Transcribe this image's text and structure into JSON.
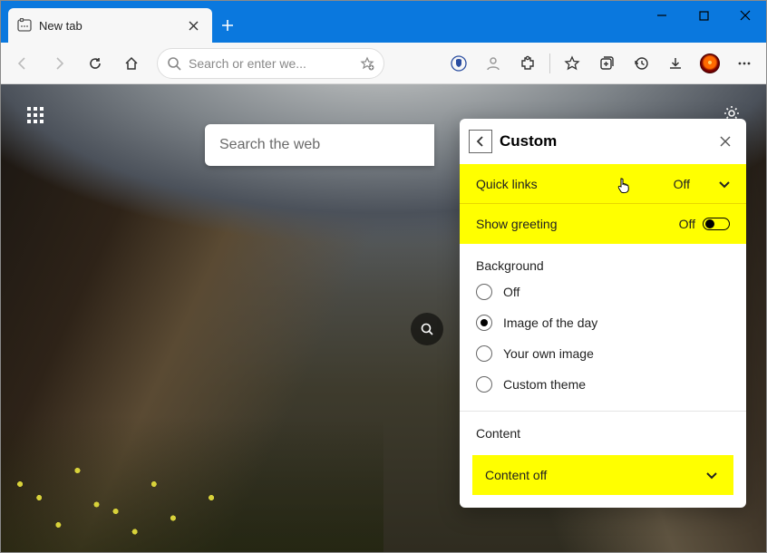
{
  "tab": {
    "title": "New tab"
  },
  "toolbar": {
    "search_placeholder": "Search or enter we..."
  },
  "ntp": {
    "search_placeholder": "Search the web"
  },
  "flyout": {
    "title": "Custom",
    "quick_links": {
      "label": "Quick links",
      "value": "Off"
    },
    "show_greeting": {
      "label": "Show greeting",
      "value": "Off"
    },
    "background": {
      "label": "Background",
      "options": [
        "Off",
        "Image of the day",
        "Your own image",
        "Custom theme"
      ],
      "selected": "Image of the day"
    },
    "content": {
      "label": "Content",
      "value": "Content off"
    }
  },
  "colors": {
    "titlebar": "#0a78de",
    "highlight": "#ffff00"
  }
}
